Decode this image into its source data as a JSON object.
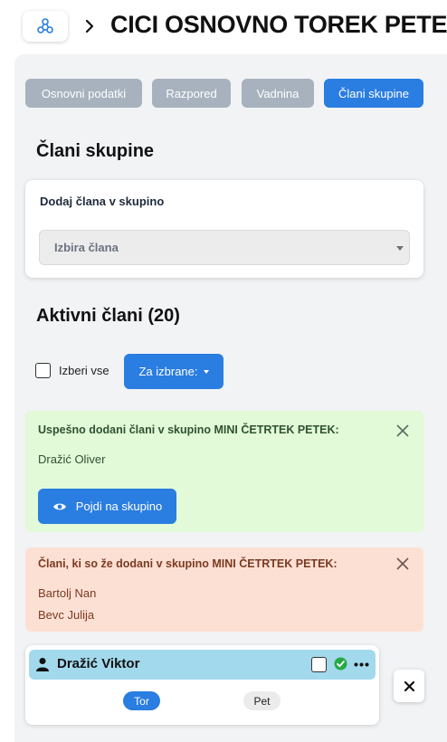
{
  "header": {
    "title": "CICI OSNOVNO TOREK PETEK",
    "logo_icon": "network-nodes-icon",
    "separator_icon": "chevron-right-icon"
  },
  "tabs": [
    {
      "label": "Osnovni podatki",
      "active": false
    },
    {
      "label": "Razpored",
      "active": false
    },
    {
      "label": "Vadnina",
      "active": false
    },
    {
      "label": "Člani skupine",
      "active": true
    }
  ],
  "members_section": {
    "title": "Člani skupine",
    "add_card": {
      "label": "Dodaj člana v skupino",
      "select_placeholder": "Izbira člana"
    }
  },
  "active_section": {
    "title": "Aktivni člani (20)",
    "select_all_label": "Izberi vse",
    "bulk_button_label": "Za izbrane:"
  },
  "success_alert": {
    "title": "Uspešno dodani člani v skupino MINI ČETRTEK PETEK:",
    "members": [
      "Dražić Oliver"
    ],
    "button_label": "Pojdi na skupino",
    "color": "#e2fad7"
  },
  "warning_alert": {
    "title": "Člani, ki so že dodani v skupino MINI ČETRTEK PETEK:",
    "members": [
      "Bartolj Nan",
      "Bevc Julija"
    ],
    "color": "#fde0d4"
  },
  "member_card": {
    "name": "Dražić Viktor",
    "status_icon": "check-circle-icon",
    "days": [
      {
        "label": "Tor",
        "selected": true
      },
      {
        "label": "Pet",
        "selected": false
      }
    ]
  },
  "colors": {
    "accent": "#2a7de1",
    "tab_inactive": "#a7b2be",
    "member_header": "#a2d9ec",
    "success_icon": "#27a844"
  }
}
